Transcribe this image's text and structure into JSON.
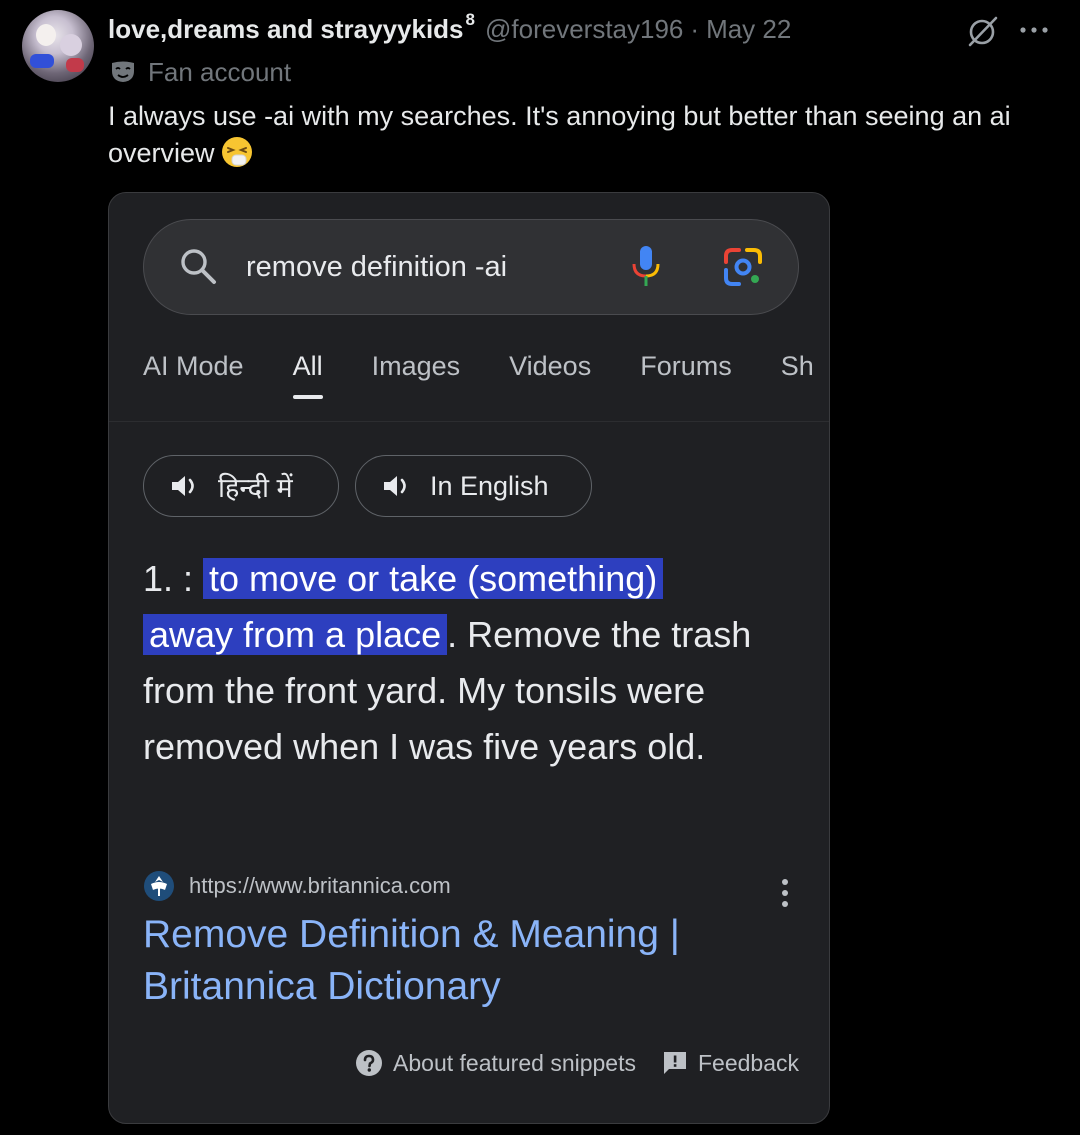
{
  "tweet": {
    "display_name": "love,dreams and strayyykids",
    "display_name_sup": "8",
    "handle": "@foreverstay196",
    "separator": "·",
    "date": "May 22",
    "account_label": "Fan account",
    "text": "I always use -ai with my searches. It's annoying but better than seeing an ai overview",
    "emoji": "sneezing-face"
  },
  "screenshot": {
    "search": {
      "query": "remove definition -ai"
    },
    "tabs": [
      {
        "label": "AI Mode",
        "active": false
      },
      {
        "label": "All",
        "active": true
      },
      {
        "label": "Images",
        "active": false
      },
      {
        "label": "Videos",
        "active": false
      },
      {
        "label": "Forums",
        "active": false
      },
      {
        "label": "Sh",
        "active": false
      }
    ],
    "pronunciation": {
      "hindi_label": "हिन्दी में",
      "english_label": "In English"
    },
    "definition": {
      "number": "1. : ",
      "highlight_line1": "to move or take (something)",
      "highlight_line2": "away from a place",
      "rest": ". Remove the trash from the front yard. My tonsils were removed when I was five years old."
    },
    "result": {
      "url": "https://www.britannica.com",
      "title": "Remove Definition & Meaning | Britannica Dictionary"
    },
    "footer": {
      "snippets_label": "About featured snippets",
      "feedback_label": "Feedback"
    }
  },
  "colors": {
    "background": "#000000",
    "card_background": "#1f2023",
    "highlight": "#2d3fbf",
    "link": "#8ab4f8",
    "muted": "#71767b"
  }
}
